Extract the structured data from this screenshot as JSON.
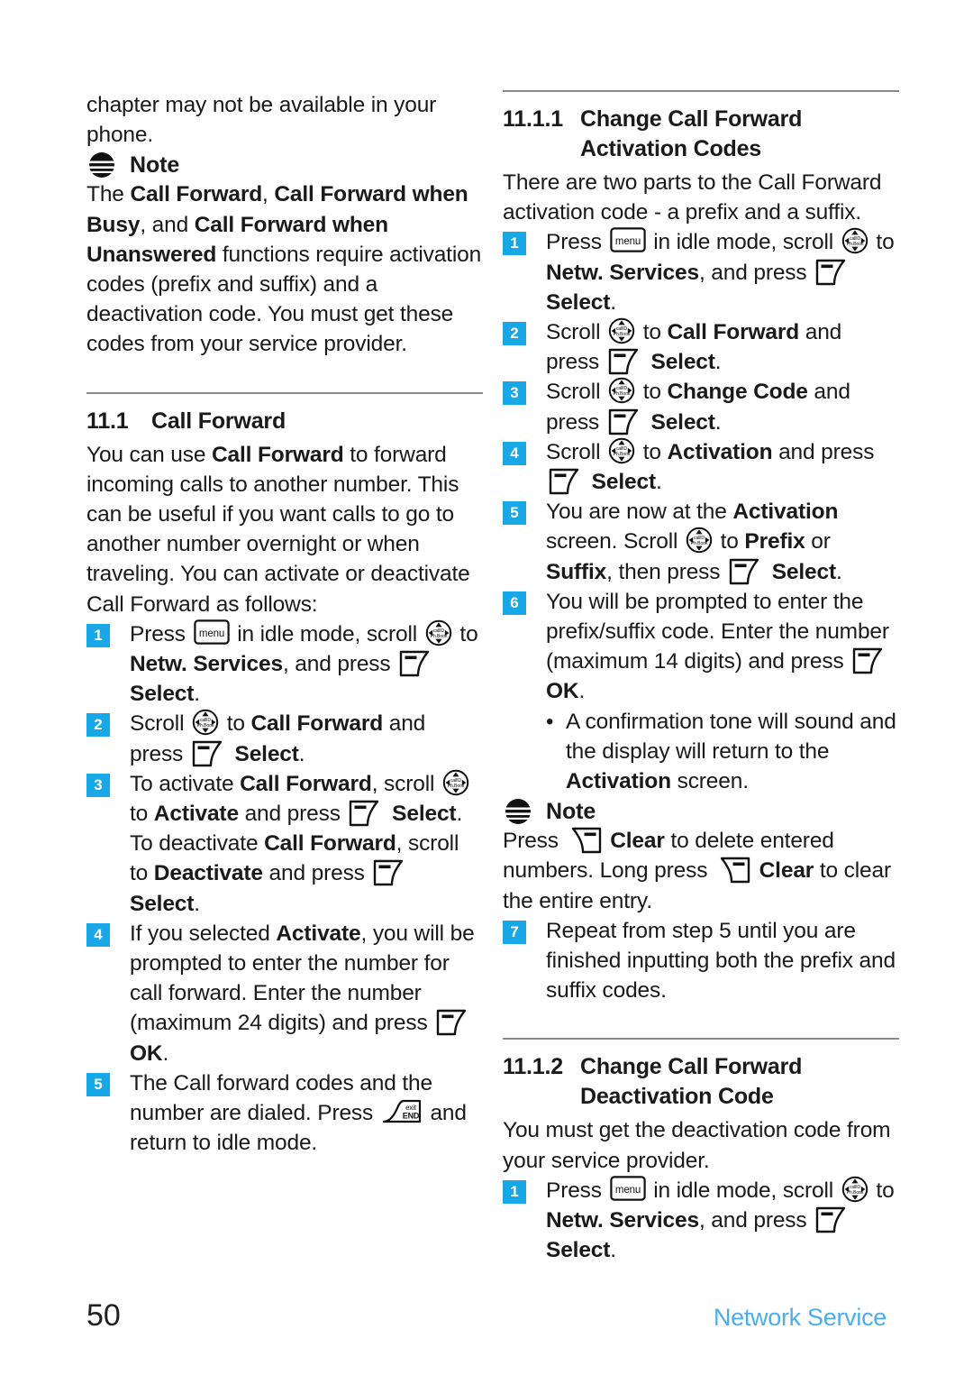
{
  "page": {
    "folio": "50",
    "running_head": "Network Service",
    "accent_color": "#18a8e8",
    "runhead_color": "#4aaef0"
  },
  "left_column": {
    "continued_paragraph": "chapter may not be available in your phone.",
    "note1": {
      "icon": "note-icon",
      "label": "Note",
      "text_parts": [
        {
          "t": "The ",
          "b": false
        },
        {
          "t": "Call Forward",
          "b": true
        },
        {
          "t": ", ",
          "b": false
        },
        {
          "t": "Call Forward when Busy",
          "b": true
        },
        {
          "t": ", and ",
          "b": false
        },
        {
          "t": "Call Forward when Unanswered",
          "b": true
        },
        {
          "t": " functions require activation codes (prefix and suffix) and a deactivation code. You must get these codes from your service provider.",
          "b": false
        }
      ]
    },
    "section": {
      "number": "11.1",
      "title": "Call Forward",
      "intro_parts": [
        {
          "t": "You can use ",
          "b": false
        },
        {
          "t": "Call Forward",
          "b": true
        },
        {
          "t": " to forward incoming calls to another number. This can be useful if you want calls to go to another number overnight or when traveling. You can activate or deactivate Call Forward as follows:",
          "b": false
        }
      ],
      "steps": [
        {
          "number": "1",
          "parts": [
            {
              "t": "Press ",
              "b": false
            },
            {
              "icon": "menu-key-icon"
            },
            {
              "t": " in idle mode, scroll ",
              "b": false
            },
            {
              "icon": "nav-scroll-key-icon"
            },
            {
              "t": " to ",
              "b": false
            },
            {
              "t": "Netw. Services",
              "b": true
            },
            {
              "t": ", and press ",
              "b": false
            },
            {
              "icon": "left-softkey-icon"
            },
            {
              "t": " ",
              "b": false
            },
            {
              "t": "Select",
              "b": true
            },
            {
              "t": ".",
              "b": false
            }
          ]
        },
        {
          "number": "2",
          "parts": [
            {
              "t": "Scroll ",
              "b": false
            },
            {
              "icon": "nav-scroll-key-icon"
            },
            {
              "t": " to ",
              "b": false
            },
            {
              "t": "Call Forward",
              "b": true
            },
            {
              "t": " and press ",
              "b": false
            },
            {
              "icon": "left-softkey-icon"
            },
            {
              "t": " ",
              "b": false
            },
            {
              "t": "Select",
              "b": true
            },
            {
              "t": ".",
              "b": false
            }
          ]
        },
        {
          "number": "3",
          "parts": [
            {
              "t": "To activate ",
              "b": false
            },
            {
              "t": "Call Forward",
              "b": true
            },
            {
              "t": ", scroll ",
              "b": false
            },
            {
              "icon": "nav-scroll-key-icon"
            },
            {
              "t": " to ",
              "b": false
            },
            {
              "t": "Activate",
              "b": true
            },
            {
              "t": " and press ",
              "b": false
            },
            {
              "icon": "left-softkey-icon"
            },
            {
              "t": " ",
              "b": false
            },
            {
              "t": "Select",
              "b": true
            },
            {
              "t": ". To deactivate ",
              "b": false
            },
            {
              "t": "Call Forward",
              "b": true
            },
            {
              "t": ", scroll to ",
              "b": false
            },
            {
              "t": "Deactivate",
              "b": true
            },
            {
              "t": " and press ",
              "b": false
            },
            {
              "icon": "left-softkey-icon"
            },
            {
              "t": " ",
              "b": false
            },
            {
              "t": "Select",
              "b": true
            },
            {
              "t": ".",
              "b": false
            }
          ]
        },
        {
          "number": "4",
          "parts": [
            {
              "t": "If you selected ",
              "b": false
            },
            {
              "t": "Activate",
              "b": true
            },
            {
              "t": ", you will be prompted to enter the number for call forward. Enter the number (maximum 24 digits) and press ",
              "b": false
            },
            {
              "icon": "left-softkey-icon"
            },
            {
              "t": " ",
              "b": false
            },
            {
              "t": "OK",
              "b": true
            },
            {
              "t": ".",
              "b": false
            }
          ]
        },
        {
          "number": "5",
          "parts": [
            {
              "t": "The Call forward codes and the number are dialed. Press ",
              "b": false
            },
            {
              "icon": "end-key-icon"
            },
            {
              "t": " and return to idle mode.",
              "b": false
            }
          ]
        }
      ]
    }
  },
  "right_column": {
    "section_1": {
      "number": "11.1.1",
      "title_line1": "Change Call Forward",
      "title_line2": "Activation Codes",
      "intro_parts": [
        {
          "t": "There are two parts to the Call Forward activation code - a prefix and a suffix.",
          "b": false
        }
      ],
      "steps": [
        {
          "number": "1",
          "parts": [
            {
              "t": "Press ",
              "b": false
            },
            {
              "icon": "menu-key-icon"
            },
            {
              "t": " in idle mode, scroll ",
              "b": false
            },
            {
              "icon": "nav-scroll-key-icon"
            },
            {
              "t": " to ",
              "b": false
            },
            {
              "t": "Netw. Services",
              "b": true
            },
            {
              "t": ", and press ",
              "b": false
            },
            {
              "icon": "left-softkey-icon"
            },
            {
              "t": " ",
              "b": false
            },
            {
              "t": "Select",
              "b": true
            },
            {
              "t": ".",
              "b": false
            }
          ]
        },
        {
          "number": "2",
          "parts": [
            {
              "t": "Scroll ",
              "b": false
            },
            {
              "icon": "nav-scroll-key-icon"
            },
            {
              "t": " to ",
              "b": false
            },
            {
              "t": "Call Forward",
              "b": true
            },
            {
              "t": " and press ",
              "b": false
            },
            {
              "icon": "left-softkey-icon"
            },
            {
              "t": " ",
              "b": false
            },
            {
              "t": "Select",
              "b": true
            },
            {
              "t": ".",
              "b": false
            }
          ]
        },
        {
          "number": "3",
          "parts": [
            {
              "t": "Scroll ",
              "b": false
            },
            {
              "icon": "nav-scroll-key-icon"
            },
            {
              "t": " to ",
              "b": false
            },
            {
              "t": "Change Code",
              "b": true
            },
            {
              "t": " and press ",
              "b": false
            },
            {
              "icon": "left-softkey-icon"
            },
            {
              "t": " ",
              "b": false
            },
            {
              "t": "Select",
              "b": true
            },
            {
              "t": ".",
              "b": false
            }
          ]
        },
        {
          "number": "4",
          "parts": [
            {
              "t": "Scroll ",
              "b": false
            },
            {
              "icon": "nav-scroll-key-icon"
            },
            {
              "t": " to ",
              "b": false
            },
            {
              "t": "Activation",
              "b": true
            },
            {
              "t": " and press ",
              "b": false
            },
            {
              "icon": "left-softkey-icon"
            },
            {
              "t": " ",
              "b": false
            },
            {
              "t": "Select",
              "b": true
            },
            {
              "t": ".",
              "b": false
            }
          ]
        },
        {
          "number": "5",
          "parts": [
            {
              "t": "You are now at the ",
              "b": false
            },
            {
              "t": "Activation",
              "b": true
            },
            {
              "t": " screen. Scroll ",
              "b": false
            },
            {
              "icon": "nav-scroll-key-icon"
            },
            {
              "t": " to ",
              "b": false
            },
            {
              "t": "Prefix",
              "b": true
            },
            {
              "t": " or ",
              "b": false
            },
            {
              "t": "Suffix",
              "b": true
            },
            {
              "t": ", then press ",
              "b": false
            },
            {
              "icon": "left-softkey-icon"
            },
            {
              "t": " ",
              "b": false
            },
            {
              "t": "Select",
              "b": true
            },
            {
              "t": ".",
              "b": false
            }
          ]
        },
        {
          "number": "6",
          "parts": [
            {
              "t": "You will be prompted to enter the prefix/suffix code. Enter the number (maximum 14 digits) and press ",
              "b": false
            },
            {
              "icon": "left-softkey-icon"
            },
            {
              "t": " ",
              "b": false
            },
            {
              "t": "OK",
              "b": true
            },
            {
              "t": ".",
              "b": false
            }
          ]
        }
      ],
      "bullet": {
        "marker": "•",
        "parts": [
          {
            "t": "A confirmation tone will sound and the display will return to the ",
            "b": false
          },
          {
            "t": "Activation",
            "b": true
          },
          {
            "t": " screen.",
            "b": false
          }
        ]
      },
      "note": {
        "icon": "note-icon",
        "label": "Note",
        "parts": [
          {
            "t": "Press ",
            "b": false
          },
          {
            "icon": "right-softkey-icon"
          },
          {
            "t": " ",
            "b": false
          },
          {
            "t": "Clear",
            "b": true
          },
          {
            "t": " to delete entered numbers. Long press ",
            "b": false
          },
          {
            "icon": "right-softkey-icon"
          },
          {
            "t": " ",
            "b": false
          },
          {
            "t": "Clear",
            "b": true
          },
          {
            "t": " to clear the entire entry.",
            "b": false
          }
        ]
      },
      "step_after_note": {
        "number": "7",
        "parts": [
          {
            "t": "Repeat from step 5 until you are finished inputting both the prefix and suffix codes.",
            "b": false
          }
        ]
      }
    },
    "section_2": {
      "number": "11.1.2",
      "title_line1": "Change Call Forward",
      "title_line2": "Deactivation Code",
      "intro_parts": [
        {
          "t": "You must get the deactivation code from your service provider.",
          "b": false
        }
      ],
      "steps": [
        {
          "number": "1",
          "parts": [
            {
              "t": "Press ",
              "b": false
            },
            {
              "icon": "menu-key-icon"
            },
            {
              "t": " in idle mode, scroll ",
              "b": false
            },
            {
              "icon": "nav-scroll-key-icon"
            },
            {
              "t": " to ",
              "b": false
            },
            {
              "t": "Netw. Services",
              "b": true
            },
            {
              "t": ", and press ",
              "b": false
            },
            {
              "icon": "left-softkey-icon"
            },
            {
              "t": " ",
              "b": false
            },
            {
              "t": "Select",
              "b": true
            },
            {
              "t": ".",
              "b": false
            }
          ]
        }
      ]
    }
  },
  "icon_labels": {
    "menu_key": "menu",
    "end_key_line1": "exit",
    "end_key_line2": "END",
    "nav_key_line1": "callID",
    "nav_key_line2": "Ph.Book"
  }
}
